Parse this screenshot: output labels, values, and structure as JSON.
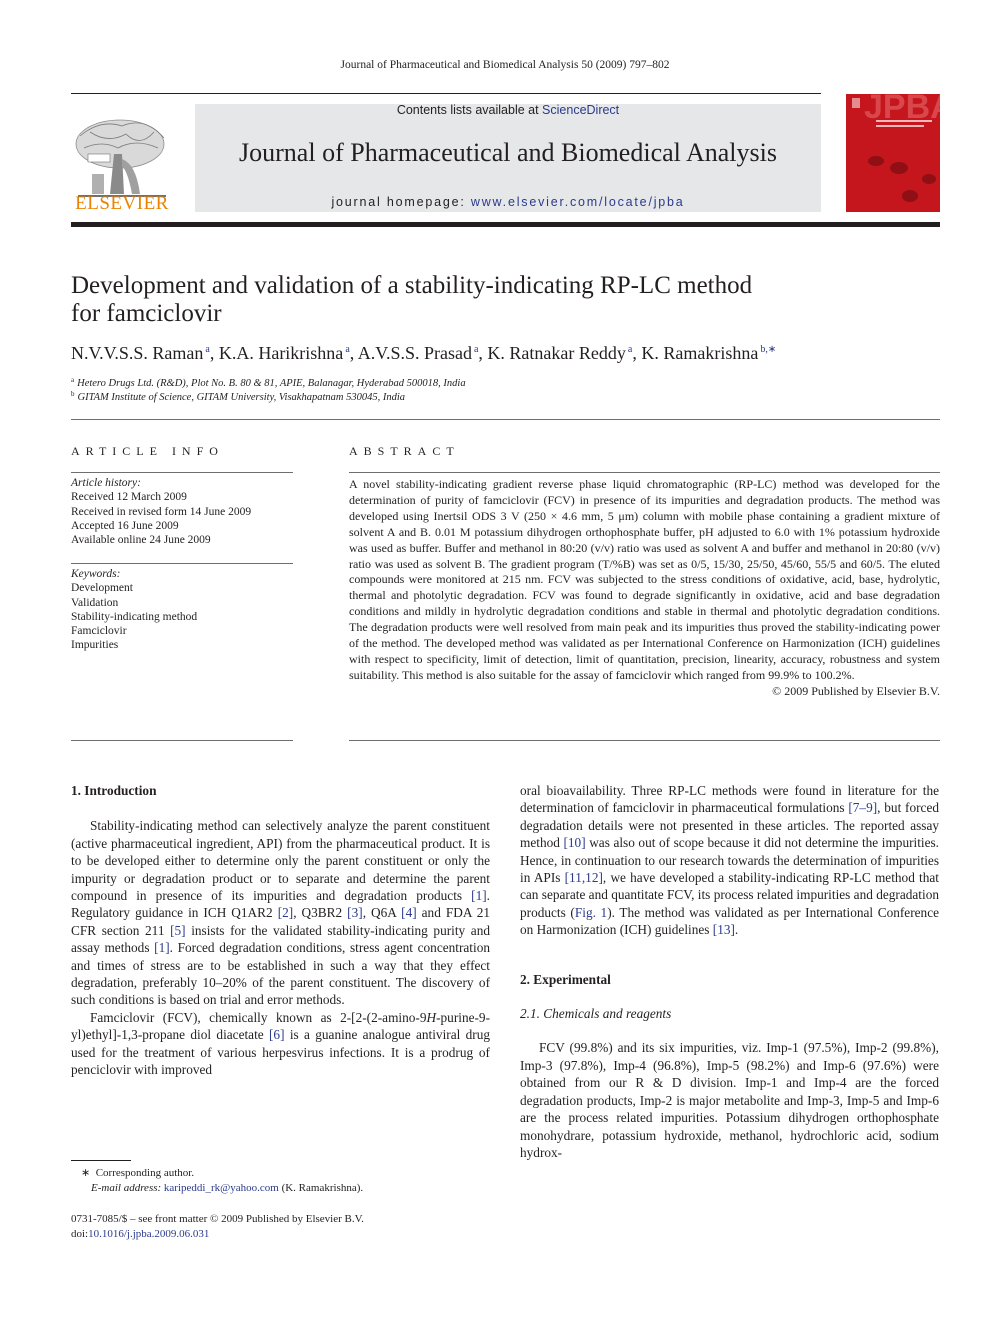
{
  "running_head": "Journal of Pharmaceutical and Biomedical Analysis 50 (2009) 797–802",
  "masthead": {
    "contents_prefix": "Contents lists available at ",
    "contents_link": "ScienceDirect",
    "journal_name": "Journal of Pharmaceutical and Biomedical Analysis",
    "homepage_prefix": "journal homepage: ",
    "homepage_link": "www.elsevier.com/locate/jpba",
    "publisher_logo_text": "ELSEVIER",
    "cover_title": "JPBA",
    "cover_color": "#c4161c",
    "publisher_color": "#e98300"
  },
  "article": {
    "title_line1": "Development and validation of a stability-indicating RP-LC method",
    "title_line2": "for famciclovir",
    "authors": [
      {
        "name": "N.V.V.S.S. Raman",
        "aff": "a"
      },
      {
        "name": "K.A. Harikrishna",
        "aff": "a"
      },
      {
        "name": "A.V.S.S. Prasad",
        "aff": "a"
      },
      {
        "name": "K. Ratnakar Reddy",
        "aff": "a"
      },
      {
        "name": "K. Ramakrishna",
        "aff": "b,∗"
      }
    ],
    "affiliations": [
      {
        "mark": "a",
        "text": "Hetero Drugs Ltd. (R&D), Plot No. B. 80 & 81, APIE, Balanagar, Hyderabad 500018, India"
      },
      {
        "mark": "b",
        "text": "GITAM Institute of Science, GITAM University, Visakhapatnam 530045, India"
      }
    ]
  },
  "article_info": {
    "heading": "ARTICLE INFO",
    "history_label": "Article history:",
    "history": [
      "Received 12 March 2009",
      "Received in revised form 14 June 2009",
      "Accepted 16 June 2009",
      "Available online 24 June 2009"
    ],
    "keywords_label": "Keywords:",
    "keywords": [
      "Development",
      "Validation",
      "Stability-indicating method",
      "Famciclovir",
      "Impurities"
    ]
  },
  "abstract": {
    "heading": "ABSTRACT",
    "text": "A novel stability-indicating gradient reverse phase liquid chromatographic (RP-LC) method was developed for the determination of purity of famciclovir (FCV) in presence of its impurities and degradation products. The method was developed using Inertsil ODS 3 V (250 × 4.6 mm, 5 μm) column with mobile phase containing a gradient mixture of solvent A and B. 0.01 M potassium dihydrogen orthophosphate buffer, pH adjusted to 6.0 with 1% potassium hydroxide was used as buffer. Buffer and methanol in 80:20 (v/v) ratio was used as solvent A and buffer and methanol in 20:80 (v/v) ratio was used as solvent B. The gradient program (T/%B) was set as 0/5, 15/30, 25/50, 45/60, 55/5 and 60/5. The eluted compounds were monitored at 215 nm. FCV was subjected to the stress conditions of oxidative, acid, base, hydrolytic, thermal and photolytic degradation. FCV was found to degrade significantly in oxidative, acid and base degradation conditions and mildly in hydrolytic degradation conditions and stable in thermal and photolytic degradation conditions. The degradation products were well resolved from main peak and its impurities thus proved the stability-indicating power of the method. The developed method was validated as per International Conference on Harmonization (ICH) guidelines with respect to specificity, limit of detection, limit of quantitation, precision, linearity, accuracy, robustness and system suitability. This method is also suitable for the assay of famciclovir which ranged from 99.9% to 100.2%.",
    "copyright": "© 2009 Published by Elsevier B.V."
  },
  "intro": {
    "heading": "1.  Introduction",
    "p1": [
      {
        "t": "Stability-indicating method can selectively analyze the parent constituent (active pharmaceutical ingredient, API) from the pharmaceutical product. It is to be developed either to determine only the parent constituent or only the impurity or degradation product or to separate and determine the parent compound in presence of its impurities and degradation products "
      },
      {
        "r": "[1]"
      },
      {
        "t": ". Regulatory guidance in ICH Q1AR2 "
      },
      {
        "r": "[2]"
      },
      {
        "t": ", Q3BR2 "
      },
      {
        "r": "[3]"
      },
      {
        "t": ", Q6A "
      },
      {
        "r": "[4]"
      },
      {
        "t": " and FDA 21 CFR section 211 "
      },
      {
        "r": "[5]"
      },
      {
        "t": " insists for the validated stability-indicating purity and assay methods "
      },
      {
        "r": "[1]"
      },
      {
        "t": ". Forced degradation conditions, stress agent concentration and times of stress are to be established in such a way that they effect degradation, preferably 10–20% of the parent constituent. The discovery of such conditions is based on trial and error methods."
      }
    ],
    "p2": [
      {
        "t": "Famciclovir (FCV), chemically known as 2-[2-(2-amino-9"
      },
      {
        "i": "H"
      },
      {
        "t": "-purine-9-yl)ethyl]-1,3-propane diol diacetate "
      },
      {
        "r": "[6]"
      },
      {
        "t": " is a guanine analogue antiviral drug used for the treatment of various herpesvirus infections. It is a prodrug of penciclovir with improved oral bioavailability. Three RP-LC methods were found in literature for the determination of famciclovir in pharmaceutical formulations "
      },
      {
        "r": "[7–9]"
      },
      {
        "t": ", but forced degradation details were not presented in these articles. The reported assay method "
      },
      {
        "r": "[10]"
      },
      {
        "t": " was also out of scope because it did not determine the impurities. Hence, in continuation to our research towards the determination of impurities in APIs "
      },
      {
        "r": "[11,12]"
      },
      {
        "t": ", we have developed a stability-indicating RP-LC method that can separate and quantitate FCV, its process related impurities and degradation products ("
      },
      {
        "r": "Fig. 1"
      },
      {
        "t": "). The method was validated as per International Conference on Harmonization (ICH) guidelines "
      },
      {
        "r": "[13]"
      },
      {
        "t": "."
      }
    ]
  },
  "experimental": {
    "heading": "2.  Experimental",
    "subheading": "2.1.  Chemicals and reagents",
    "p1": "FCV (99.8%) and its six impurities, viz. Imp-1 (97.5%), Imp-2 (99.8%), Imp-3 (97.8%), Imp-4 (96.8%), Imp-5 (98.2%) and Imp-6 (97.6%) were obtained from our R & D division. Imp-1 and Imp-4 are the forced degradation products, Imp-2 is major metabolite and Imp-3, Imp-5 and Imp-6 are the process related impurities. Potassium dihydrogen orthophosphate monohydrare, potassium hydroxide, methanol, hydrochloric acid, sodium hydrox-"
  },
  "footnote": {
    "star": "∗",
    "corresponding": "Corresponding author.",
    "email_label": "E-mail address:",
    "email": "karipeddi_rk@yahoo.com",
    "email_owner": "(K. Ramakrishna)."
  },
  "frontmatter": {
    "issn": "0731-7085/$ – see front matter © 2009 Published by Elsevier B.V.",
    "doi_label": "doi:",
    "doi": "10.1016/j.jpba.2009.06.031"
  }
}
